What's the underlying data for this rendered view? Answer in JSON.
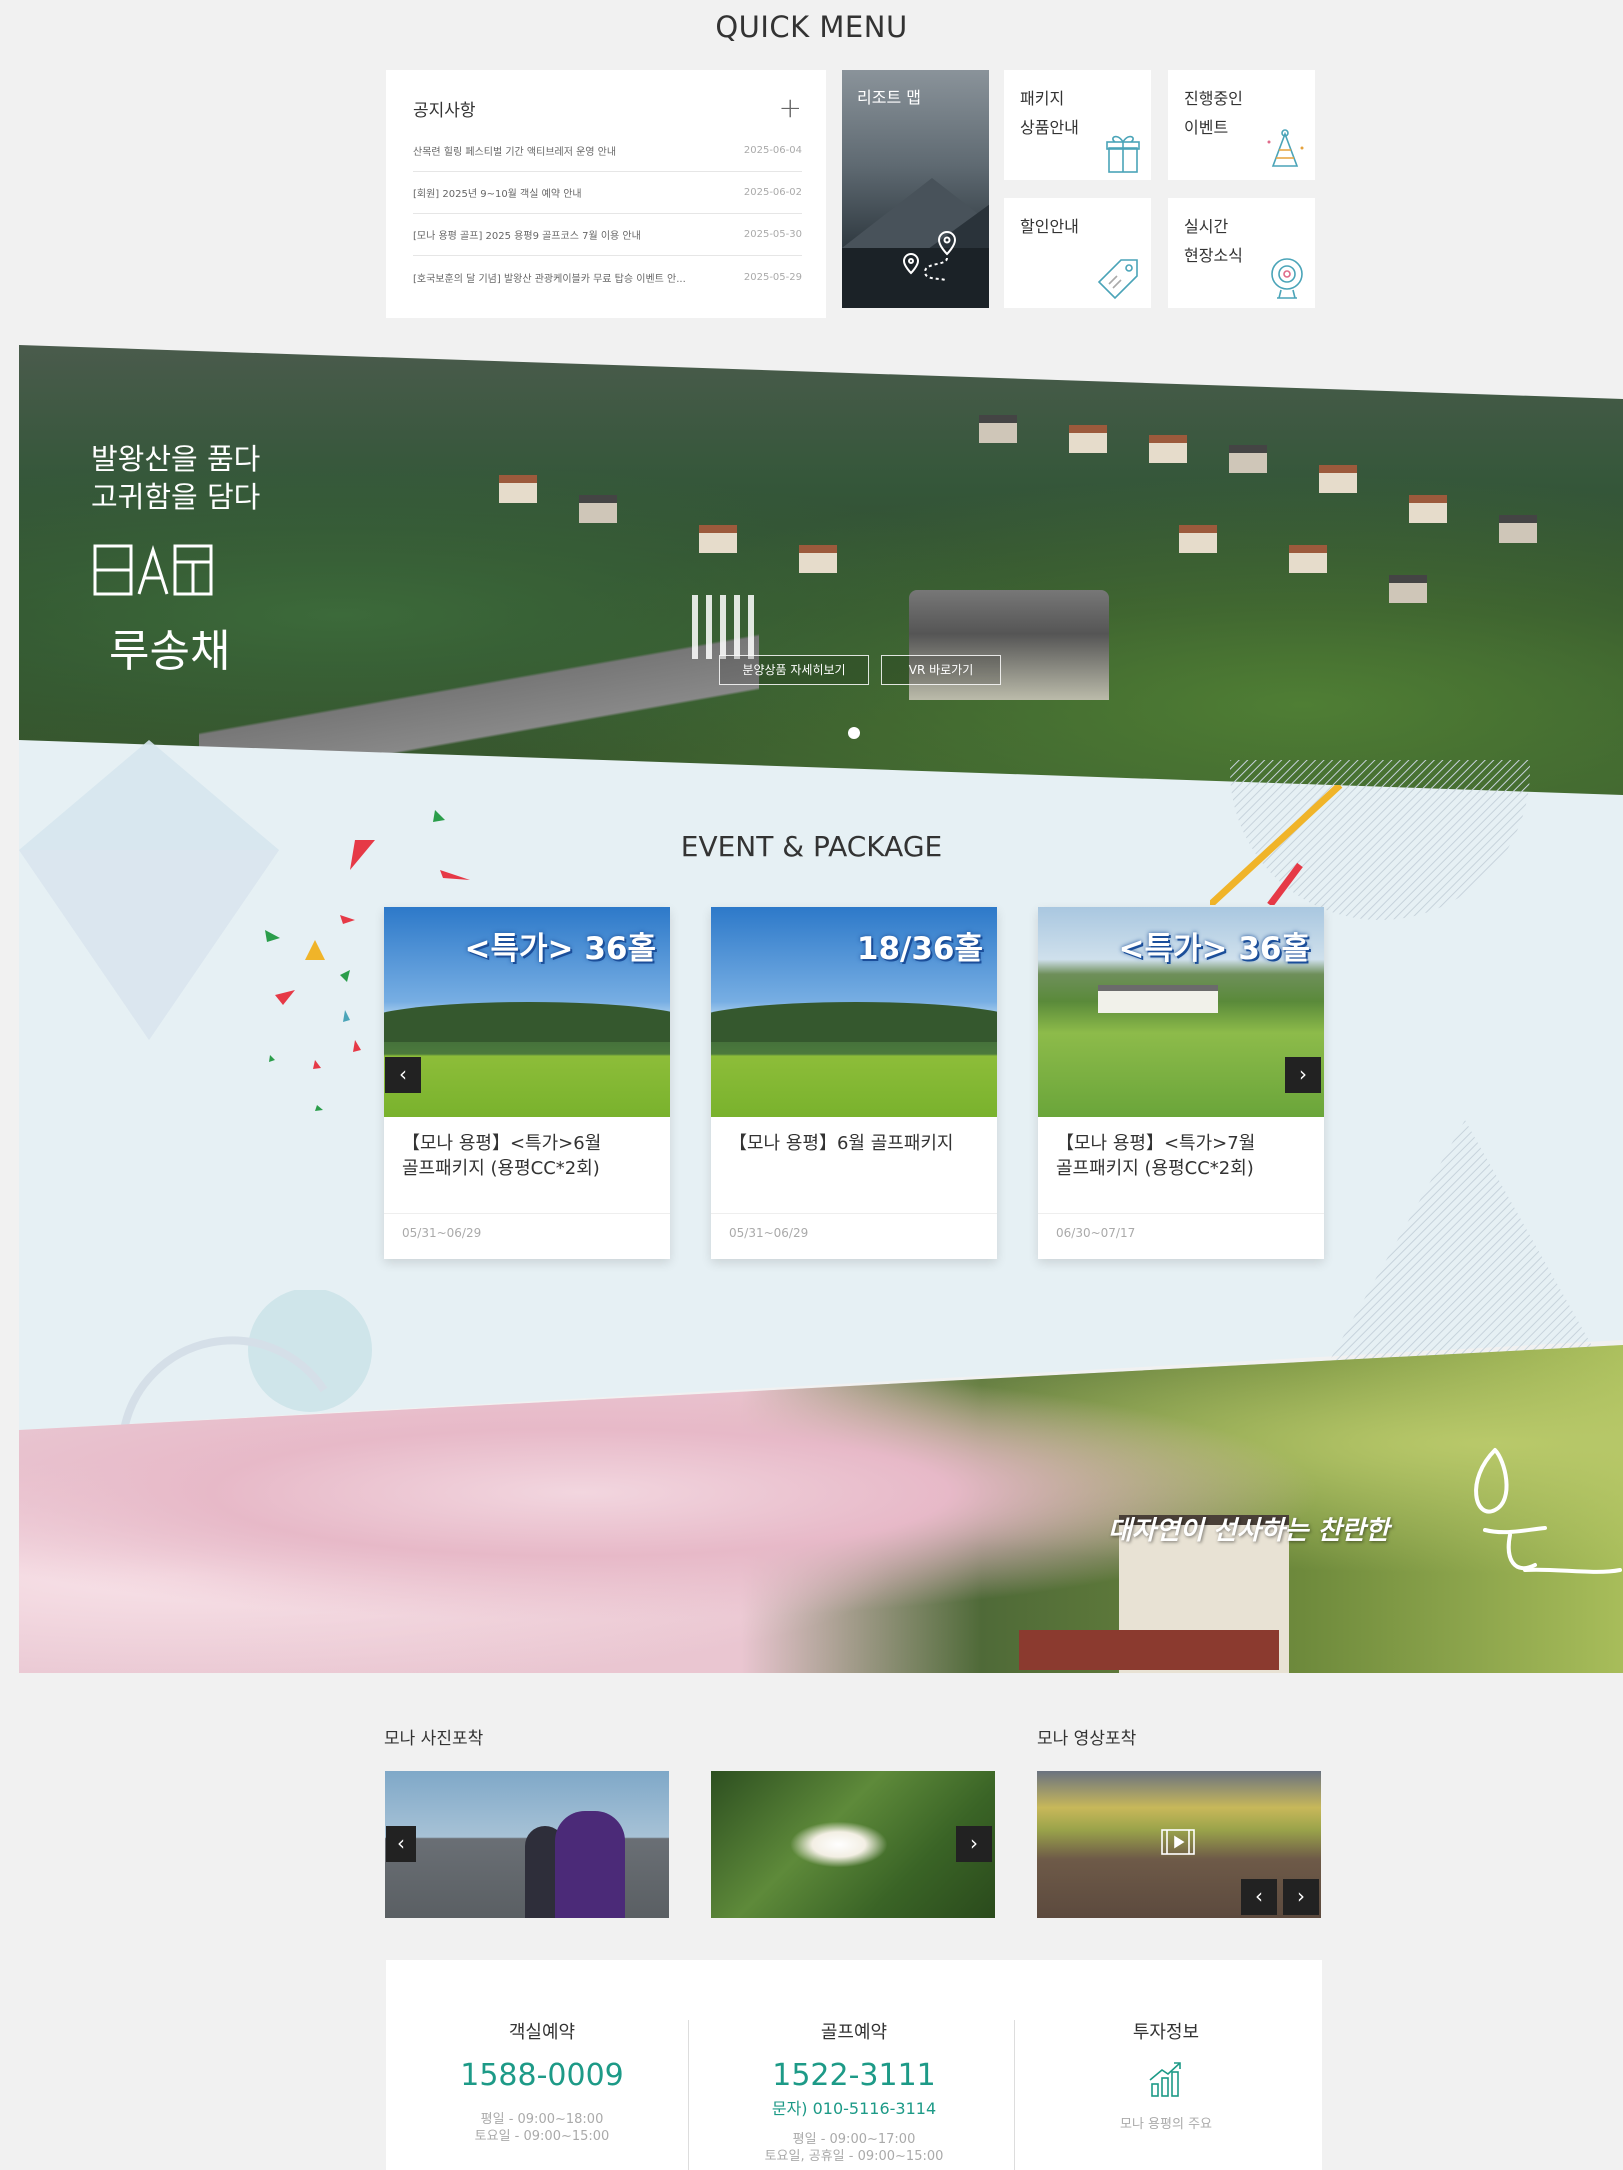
{
  "quick_menu": {
    "title": "QUICK MENU",
    "notice": {
      "title": "공지사항",
      "more_icon": "plus-icon",
      "items": [
        {
          "text": "산목련 힐링 페스티벌 기간 액티브레저 운영 안내",
          "date": "2025-06-04"
        },
        {
          "text": "[회원] 2025년 9~10월 객실 예약 안내",
          "date": "2025-06-02"
        },
        {
          "text": "[모나 용평 골프] 2025 용평9 골프코스 7월 이용 안내",
          "date": "2025-05-30"
        },
        {
          "text": "[호국보훈의 달 기념] 발왕산 관광케이블카 무료 탑승 이벤트 안...",
          "date": "2025-05-29"
        }
      ]
    },
    "resort_app": {
      "label": "리조트 맵",
      "icon": "map-route-icon"
    },
    "tiles": [
      {
        "line1": "패키지",
        "line2": "상품안내",
        "icon": "gift-icon"
      },
      {
        "line1": "진행중인",
        "line2": "이벤트",
        "icon": "party-hat-icon"
      },
      {
        "line1": "할인안내",
        "line2": "",
        "icon": "tag-icon"
      },
      {
        "line1": "실시간",
        "line2": "현장소식",
        "icon": "webcam-icon"
      }
    ]
  },
  "hero": {
    "line1": "발왕산을 품다",
    "line2": "고귀함을 담다",
    "logo_text": "루송채",
    "btn_detail": "분양상품 자세히보기",
    "btn_vr": "VR 바로가기"
  },
  "events": {
    "title": "EVENT & PACKAGE",
    "cards": [
      {
        "badge": "<특가> 36홀",
        "title_line1": "【모나 용평】<특가>6월",
        "title_line2": "골프패키지 (용평CC*2회)",
        "date": "05/31~06/29"
      },
      {
        "badge": "18/36홀",
        "title_line1": "【모나 용평】6월 골프패키지",
        "title_line2": "",
        "date": "05/31~06/29"
      },
      {
        "badge": "<특가> 36홀",
        "title_line1": "【모나 용평】<특가>7월",
        "title_line2": "골프패키지 (용평CC*2회)",
        "date": "06/30~07/17"
      }
    ],
    "prev_arrow": "‹",
    "next_arrow": "›"
  },
  "spring_banner": {
    "text": "대자연이 선사하는 찬란한"
  },
  "gallery": {
    "photo_title": "모나 사진포착",
    "video_title": "모나 영상포착",
    "prev_arrow": "‹",
    "next_arrow": "›"
  },
  "contact": {
    "room": {
      "title": "객실예약",
      "phone": "1588-0009",
      "hours1": "평일 - 09:00~18:00",
      "hours2": "토요일 - 09:00~15:00"
    },
    "golf": {
      "title": "골프예약",
      "phone": "1522-3111",
      "sms": "문자) 010-5116-3114",
      "hours1": "평일 - 09:00~17:00",
      "hours2": "토요일, 공휴일 - 09:00~15:00"
    },
    "invest": {
      "title": "투자정보",
      "icon": "chart-growth-icon",
      "desc": "모나 용평의 주요"
    }
  },
  "colors": {
    "accent_green": "#1d9a87",
    "event_bg": "#e6f0f4",
    "badge_blue": "#1c4f9a"
  }
}
